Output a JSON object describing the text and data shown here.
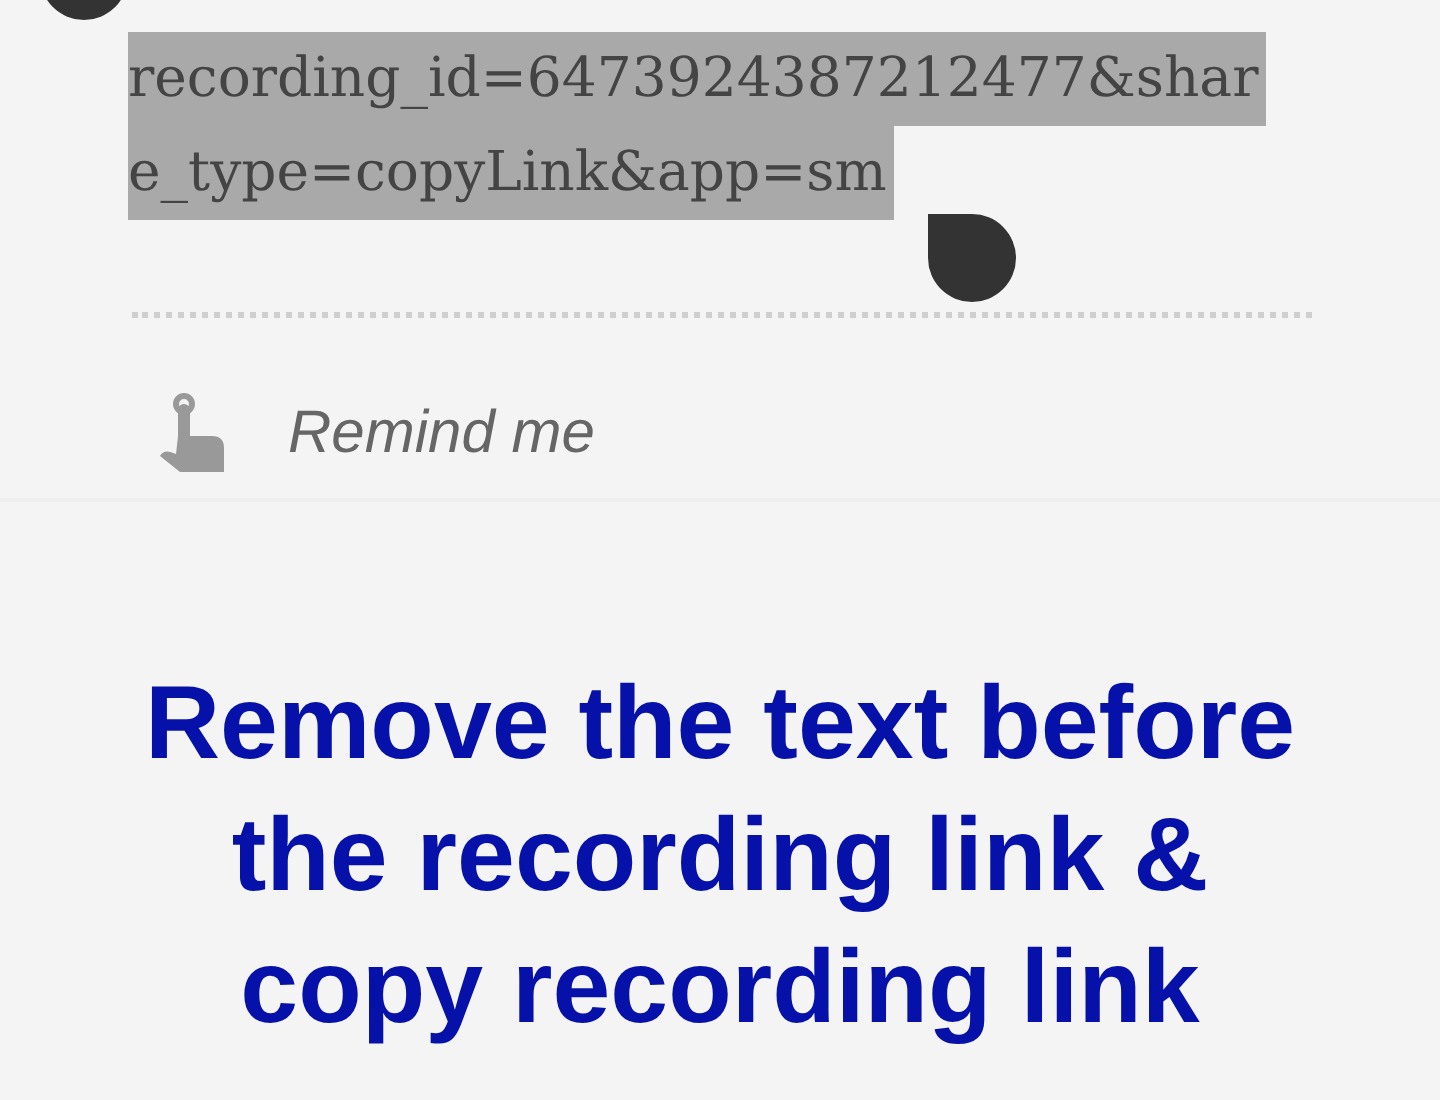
{
  "selection": {
    "lines": [
      "recording_id=6473924387212477&shar",
      "e_type=copyLink&app=sm"
    ]
  },
  "remind": {
    "label": "Remind me"
  },
  "caption": {
    "lines": [
      "Remove the text before",
      "the recording link &",
      "copy recording link"
    ]
  }
}
